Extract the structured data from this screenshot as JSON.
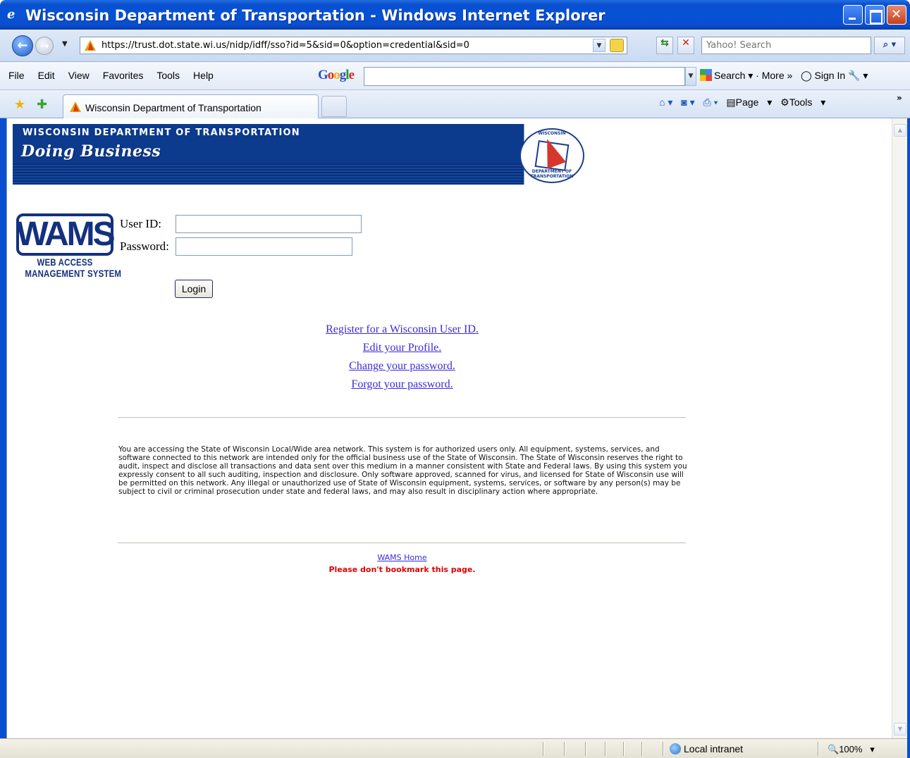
{
  "window": {
    "title": "Wisconsin Department of Transportation - Windows Internet Explorer"
  },
  "address_bar": {
    "url": "https://trust.dot.state.wi.us/nidp/idff/sso?id=5&sid=0&option=credential&sid=0",
    "search_placeholder": "Yahoo! Search"
  },
  "menu": {
    "items": [
      "File",
      "Edit",
      "View",
      "Favorites",
      "Tools",
      "Help"
    ]
  },
  "google_toolbar": {
    "logo": "Google",
    "search_label": "Search",
    "more_label": "More »",
    "signin_label": "Sign In"
  },
  "tabs": {
    "active_label": "Wisconsin Department of Transportation"
  },
  "command_bar": {
    "page_label": "Page",
    "tools_label": "Tools"
  },
  "banner": {
    "department": "WISCONSIN DEPARTMENT OF TRANSPORTATION",
    "tagline": "Doing Business",
    "seal_top": "WISCONSIN",
    "seal_bottom": "DEPARTMENT OF TRANSPORTATION"
  },
  "wams_logo": {
    "mark": "WAMS",
    "line1": "WEB ACCESS",
    "line2": "MANAGEMENT SYSTEM"
  },
  "login": {
    "userid_label": "User ID:",
    "password_label": "Password:",
    "userid_value": "",
    "password_value": "",
    "button_label": "Login"
  },
  "links": [
    "Register for a Wisconsin User ID.",
    "Edit your Profile.",
    "Change your password.",
    "Forgot your password."
  ],
  "disclaimer": "You are accessing the State of Wisconsin Local/Wide area network. This system is for authorized users only. All equipment, systems, services, and software connected to this network are intended only for the official business use of the State of Wisconsin. The State of Wisconsin reserves the right to audit, inspect and disclose all transactions and data sent over this medium in a manner consistent with State and Federal laws. By using this system you expressly consent to all such auditing, inspection and disclosure. Only software approved, scanned for virus, and licensed for State of Wisconsin use will be permitted on this network. Any illegal or unauthorized use of State of Wisconsin equipment, systems, services, or software by any person(s) may be subject to civil or criminal prosecution under state and federal laws, and may also result in disciplinary action where appropriate.",
  "footer": {
    "home_link": "WAMS Home",
    "warning": "Please don't bookmark this page."
  },
  "status_bar": {
    "zone": "Local intranet",
    "zoom": "100%"
  },
  "colors": {
    "title_bar": "#0452d6",
    "banner_blue": "#0c3a8c",
    "wams_blue": "#14317f",
    "link": "#3a2bd8",
    "warning_red": "#e00000"
  }
}
